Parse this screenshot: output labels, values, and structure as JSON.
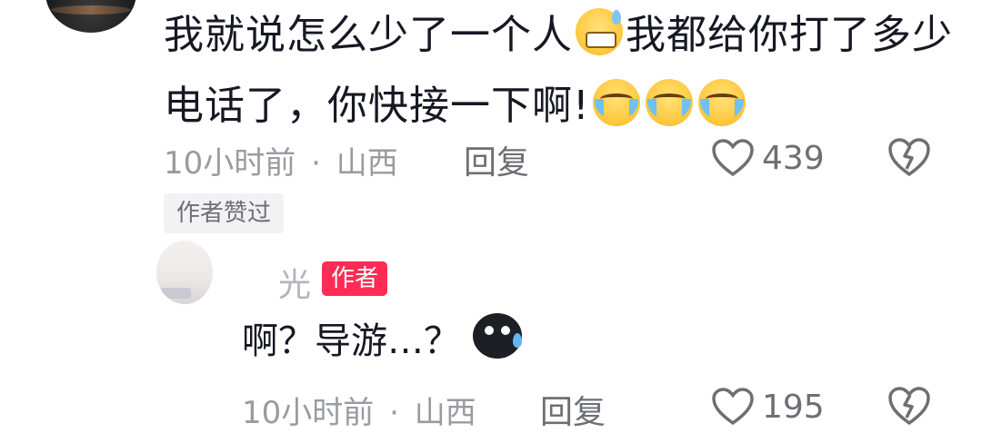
{
  "comment": {
    "text_part1": "我就说怎么少了一个人",
    "text_part2": "我都给你打了多少电话了，你快接一下啊!",
    "emoji_sweat": "grinning-sweat-emoji",
    "emoji_cry": "crying-emoji",
    "time": "10小时前",
    "separator": "·",
    "location": "山西",
    "reply_label": "回复",
    "likes": "439"
  },
  "liked_by_author_badge": "作者赞过",
  "author_reply": {
    "username": "光",
    "author_badge": "作者",
    "text": "啊？导游…？",
    "emoji": "dark-sweat-emoji",
    "time": "10小时前",
    "separator": "·",
    "location": "山西",
    "reply_label": "回复",
    "likes": "195"
  },
  "colors": {
    "accent": "#fe2c55",
    "text_primary": "#161823",
    "text_secondary": "#9a9ba1"
  }
}
